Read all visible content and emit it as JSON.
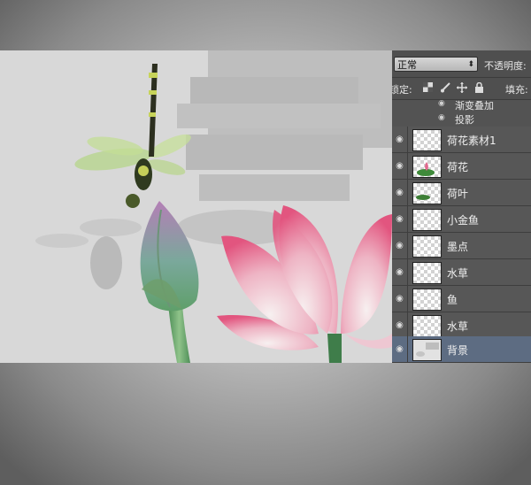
{
  "layers_panel": {
    "blend_mode": "正常",
    "opacity_label": "不透明度:",
    "lock_label": "锁定:",
    "fill_label": "填充:",
    "lock_icons": [
      "transparency-lock-icon",
      "brush-icon",
      "move-icon",
      "padlock-icon"
    ],
    "effects": [
      {
        "label": "渐变叠加"
      },
      {
        "label": "投影"
      }
    ],
    "layers": [
      {
        "name": "荷花素材1",
        "thumb": "lotus-leaf-mini",
        "selected": false
      },
      {
        "name": "荷花",
        "thumb": "lotus",
        "selected": false
      },
      {
        "name": "荷叶",
        "thumb": "leaf",
        "selected": false
      },
      {
        "name": "小金鱼",
        "thumb": "transparent",
        "selected": false
      },
      {
        "name": "墨点",
        "thumb": "transparent",
        "selected": false
      },
      {
        "name": "水草",
        "thumb": "transparent",
        "selected": false
      },
      {
        "name": "鱼",
        "thumb": "transparent",
        "selected": false
      },
      {
        "name": "水草",
        "thumb": "transparent",
        "selected": false
      },
      {
        "name": "背景",
        "thumb": "background",
        "selected": true
      }
    ]
  },
  "colors": {
    "canvas_bg": "#d8d8d8",
    "panel_bg": "#535353",
    "selected_layer": "#5d6c82",
    "lotus_pink": "#e86a8f",
    "stem_green": "#5f9a62"
  }
}
